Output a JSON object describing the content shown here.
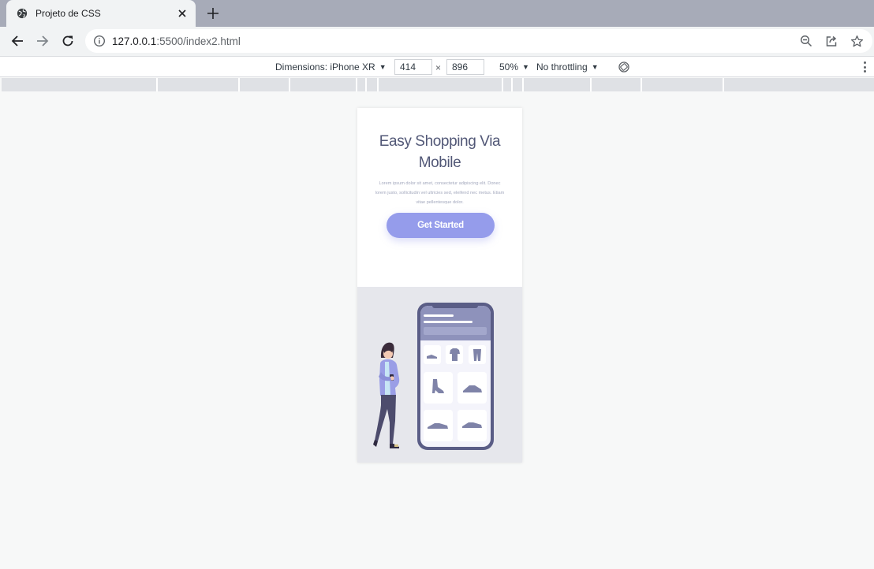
{
  "tab": {
    "title": "Projeto de CSS",
    "favicon": "globe-icon",
    "close_icon": "close-icon"
  },
  "newtab": {
    "icon": "plus-icon"
  },
  "toolbar": {
    "back_icon": "arrow-left-icon",
    "forward_icon": "arrow-right-icon",
    "reload_icon": "reload-icon",
    "url_host": "127.0.0.1",
    "url_path": ":5500/index2.html",
    "site_info_icon": "info-icon",
    "zoom_icon": "zoom-out-icon",
    "share_icon": "share-icon",
    "bookmark_icon": "star-icon"
  },
  "devtools": {
    "dimensions_label": "Dimensions: iPhone XR",
    "width": "414",
    "height": "896",
    "times": "×",
    "zoom": "50%",
    "throttling": "No throttling",
    "dropdown_glyph": "▼",
    "rotate_icon": "rotate-icon",
    "more_icon": "more-vert-icon"
  },
  "page": {
    "title_line1": "Easy Shopping Via",
    "title_line2": "Mobile",
    "description": "Lorem ipsum dolor sit amet, consectetur adipiscing elit. Donec lorem justo, sollicitudin vel ultricies sed, eleifend nec metus. Etiam vitae pellentesque dolor.",
    "cta_label": "Get Started",
    "illustration": "woman-with-phone-shopping-illustration"
  },
  "colors": {
    "accent": "#959ceb",
    "title": "#525877",
    "muted_text": "#a3a8bd",
    "illustration_bg": "#e6e7ec",
    "phone_frame": "#5a5d86"
  }
}
